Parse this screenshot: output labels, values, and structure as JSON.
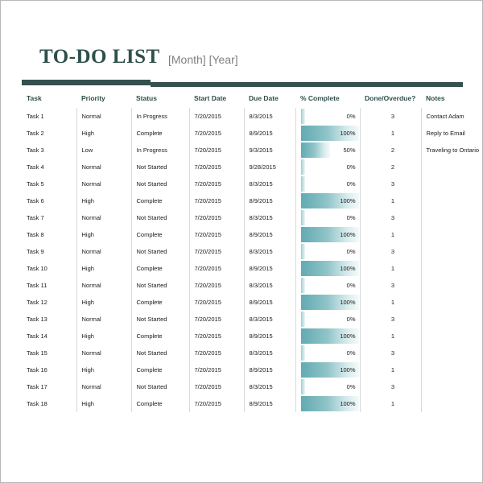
{
  "document": {
    "title": "TO-DO LIST",
    "subtitle": "[Month] [Year]"
  },
  "theme": {
    "accent_dark": "#35514f",
    "title_color": "#2f4f4a",
    "bar_color": "#62aab2",
    "subtitle_color": "#808080",
    "grid_color": "#d9d9d9"
  },
  "table": {
    "columns": [
      {
        "key": "task",
        "label": "Task"
      },
      {
        "key": "priority",
        "label": "Priority"
      },
      {
        "key": "status",
        "label": "Status"
      },
      {
        "key": "start",
        "label": "Start Date"
      },
      {
        "key": "due",
        "label": "Due Date"
      },
      {
        "key": "pct",
        "label": "% Complete"
      },
      {
        "key": "done",
        "label": "Done/Overdue?"
      },
      {
        "key": "notes",
        "label": "Notes"
      }
    ],
    "rows": [
      {
        "task": "Task 1",
        "priority": "Normal",
        "status": "In Progress",
        "start": "7/20/2015",
        "due": "8/3/2015",
        "pct": "0%",
        "pct_value": 0,
        "done": "3",
        "notes": "Contact Adam"
      },
      {
        "task": "Task 2",
        "priority": "High",
        "status": "Complete",
        "start": "7/20/2015",
        "due": "8/9/2015",
        "pct": "100%",
        "pct_value": 100,
        "done": "1",
        "notes": "Reply to Email"
      },
      {
        "task": "Task 3",
        "priority": "Low",
        "status": "In Progress",
        "start": "7/20/2015",
        "due": "9/3/2015",
        "pct": "50%",
        "pct_value": 50,
        "done": "2",
        "notes": "Traveling to Ontario"
      },
      {
        "task": "Task 4",
        "priority": "Normal",
        "status": "Not Started",
        "start": "7/20/2015",
        "due": "9/28/2015",
        "pct": "0%",
        "pct_value": 0,
        "done": "2",
        "notes": ""
      },
      {
        "task": "Task 5",
        "priority": "Normal",
        "status": "Not Started",
        "start": "7/20/2015",
        "due": "8/3/2015",
        "pct": "0%",
        "pct_value": 0,
        "done": "3",
        "notes": ""
      },
      {
        "task": "Task 6",
        "priority": "High",
        "status": "Complete",
        "start": "7/20/2015",
        "due": "8/9/2015",
        "pct": "100%",
        "pct_value": 100,
        "done": "1",
        "notes": ""
      },
      {
        "task": "Task 7",
        "priority": "Normal",
        "status": "Not Started",
        "start": "7/20/2015",
        "due": "8/3/2015",
        "pct": "0%",
        "pct_value": 0,
        "done": "3",
        "notes": ""
      },
      {
        "task": "Task 8",
        "priority": "High",
        "status": "Complete",
        "start": "7/20/2015",
        "due": "8/9/2015",
        "pct": "100%",
        "pct_value": 100,
        "done": "1",
        "notes": ""
      },
      {
        "task": "Task 9",
        "priority": "Normal",
        "status": "Not Started",
        "start": "7/20/2015",
        "due": "8/3/2015",
        "pct": "0%",
        "pct_value": 0,
        "done": "3",
        "notes": ""
      },
      {
        "task": "Task 10",
        "priority": "High",
        "status": "Complete",
        "start": "7/20/2015",
        "due": "8/9/2015",
        "pct": "100%",
        "pct_value": 100,
        "done": "1",
        "notes": ""
      },
      {
        "task": "Task 11",
        "priority": "Normal",
        "status": "Not Started",
        "start": "7/20/2015",
        "due": "8/3/2015",
        "pct": "0%",
        "pct_value": 0,
        "done": "3",
        "notes": ""
      },
      {
        "task": "Task 12",
        "priority": "High",
        "status": "Complete",
        "start": "7/20/2015",
        "due": "8/9/2015",
        "pct": "100%",
        "pct_value": 100,
        "done": "1",
        "notes": ""
      },
      {
        "task": "Task 13",
        "priority": "Normal",
        "status": "Not Started",
        "start": "7/20/2015",
        "due": "8/3/2015",
        "pct": "0%",
        "pct_value": 0,
        "done": "3",
        "notes": ""
      },
      {
        "task": "Task 14",
        "priority": "High",
        "status": "Complete",
        "start": "7/20/2015",
        "due": "8/9/2015",
        "pct": "100%",
        "pct_value": 100,
        "done": "1",
        "notes": ""
      },
      {
        "task": "Task 15",
        "priority": "Normal",
        "status": "Not Started",
        "start": "7/20/2015",
        "due": "8/3/2015",
        "pct": "0%",
        "pct_value": 0,
        "done": "3",
        "notes": ""
      },
      {
        "task": "Task 16",
        "priority": "High",
        "status": "Complete",
        "start": "7/20/2015",
        "due": "8/9/2015",
        "pct": "100%",
        "pct_value": 100,
        "done": "1",
        "notes": ""
      },
      {
        "task": "Task 17",
        "priority": "Normal",
        "status": "Not Started",
        "start": "7/20/2015",
        "due": "8/3/2015",
        "pct": "0%",
        "pct_value": 0,
        "done": "3",
        "notes": ""
      },
      {
        "task": "Task 18",
        "priority": "High",
        "status": "Complete",
        "start": "7/20/2015",
        "due": "8/9/2015",
        "pct": "100%",
        "pct_value": 100,
        "done": "1",
        "notes": ""
      }
    ]
  }
}
